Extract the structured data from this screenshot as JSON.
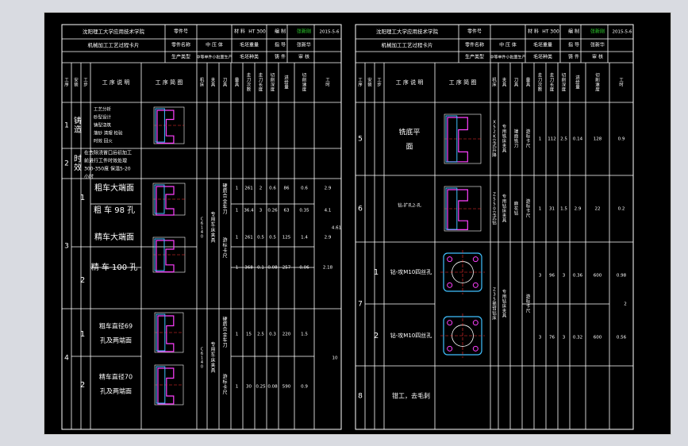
{
  "left_card": {
    "header": {
      "company": "沈阳理工大学应用技术学院",
      "part_no_label": "零件号",
      "material_label": "材 料",
      "material": "HT 300",
      "drawn_label": "编 制",
      "drawn": "张新刚",
      "date": "2015-5-6",
      "card_title": "机械加工工艺过程卡片",
      "part_name_label": "零件名称",
      "part_name": "中 压 体",
      "blank_weight_label": "毛坯重量",
      "guide_label": "指 导",
      "guide": "张新华",
      "type_label": "生产类型",
      "type": "中等单件小批量生产",
      "blank_type_label": "毛坯种类",
      "blank_type": "铸 件",
      "check_label": "审 核"
    },
    "columns": [
      "工序",
      "安装",
      "工步",
      "工 序 说 明",
      "工 序 简 图",
      "机床",
      "夹具",
      "刀具",
      "量具",
      "走刀次数",
      "走刀长度",
      "切削深度",
      "进给量",
      "切削速度",
      "工时"
    ],
    "rows": [
      {
        "no": "1",
        "name": "铸造",
        "desc_lines": [
          "工艺分析",
          "砂型设计",
          "铸型浇筑",
          "落砂 清理 检验",
          "时效 回火"
        ]
      },
      {
        "no": "2",
        "name": "时效",
        "desc_lines": [
          "在去除浇冒口后初加工",
          "前进行工件时效处理",
          "300-350度 保温5-20",
          "小时"
        ]
      },
      {
        "no": "3",
        "steps": [
          {
            "step": "1",
            "desc": "粗车大端面",
            "values": [
              "1",
              "261",
              "2",
              "0.6",
              "86",
              "0.6",
              "2.9"
            ]
          },
          {
            "step": "",
            "desc": "粗 车 98 孔",
            "values": [
              "1",
              "36.4",
              "3",
              "0.26",
              "63",
              "0.35",
              "4.1"
            ]
          },
          {
            "step": "2",
            "desc": "精车大端面",
            "values": [
              "1",
              "261",
              "0.5",
              "0.5",
              "125",
              "1.4",
              "2.9"
            ]
          },
          {
            "step": "",
            "desc": "精 车 100 孔",
            "values": [
              "1",
              "368",
              "0.1",
              "0.08",
              "257",
              "0.06",
              "2.18"
            ]
          }
        ],
        "machine": "C6140卧式车床",
        "fixture": "专用车床夹具",
        "tool": "硬质合金车刀",
        "gauge": "游标卡尺",
        "time": "4.61"
      },
      {
        "no": "4",
        "steps": [
          {
            "step": "1",
            "desc": "粗车直径69孔及两端面",
            "values": [
              "1",
              "15",
              "2.5",
              "0.3",
              "220",
              "1.5"
            ]
          },
          {
            "step": "2",
            "desc": "精车直径70孔及两端面",
            "values": [
              "1",
              "30",
              "0.25",
              "0.08",
              "590",
              "0.9"
            ]
          }
        ],
        "machine": "C6140卧式车床",
        "fixture": "专用车床夹具",
        "tool": "硬质合金车刀",
        "gauge": "游标卡尺",
        "time": "10"
      }
    ]
  },
  "right_card": {
    "header": {
      "company": "沈阳理工大学应用技术学院",
      "part_no_label": "零件号",
      "material_label": "材 料",
      "material": "HT 300",
      "drawn_label": "编 制",
      "drawn": "张新刚",
      "date": "2015-5-6",
      "card_title": "机械加工工艺过程卡片",
      "part_name_label": "零件名称",
      "part_name": "中 压 体",
      "blank_weight_label": "毛坯重量",
      "guide_label": "指 导",
      "guide": "张新华",
      "type_label": "生产类型",
      "type": "中等单件小批量生产",
      "blank_type_label": "毛坯种类",
      "blank_type": "铸 件",
      "check_label": "审 核"
    },
    "columns": [
      "工序",
      "安装",
      "工步",
      "工 序 说 明",
      "工 序 简 图",
      "机床",
      "夹具",
      "刀具",
      "量具",
      "走刀次数",
      "走刀长度",
      "切削深度",
      "进给量",
      "切削速度",
      "工时"
    ],
    "rows": [
      {
        "no": "5",
        "desc_lines": [
          "铣底平",
          "面"
        ],
        "machine": "X52K立式升降台铣床",
        "fixture": "专用铣床夹具",
        "tool": "端面铣刀",
        "gauge": "游标卡尺",
        "values": [
          "1",
          "112",
          "2.5",
          "0.14",
          "128",
          "0.9",
          "2"
        ]
      },
      {
        "no": "6",
        "desc": "钻-扩孔2-孔",
        "machine": "Z550立式钻床",
        "fixture": "专用钻床夹具",
        "tool": "麻花钻",
        "gauge": "游标卡尺",
        "values": [
          "1",
          "31",
          "1.5",
          "2.9",
          "22",
          "0.2",
          "2"
        ]
      },
      {
        "no": "7",
        "steps": [
          {
            "step": "1",
            "desc": "钻-攻M10四丝孔",
            "values": [
              "3",
              "96",
              "3",
              "0.36",
              "600",
              "0.98"
            ]
          },
          {
            "step": "2",
            "desc": "钻-攻M10四丝孔",
            "values": [
              "3",
              "76",
              "3",
              "0.32",
              "600",
              "0.56",
              "1.4"
            ]
          }
        ],
        "machine": "Z35摇臂钻床",
        "fixture": "专用钻床夹具",
        "gauge": "游标卡尺",
        "time": "2"
      },
      {
        "no": "8",
        "desc": "钳工，去毛刺"
      }
    ]
  }
}
